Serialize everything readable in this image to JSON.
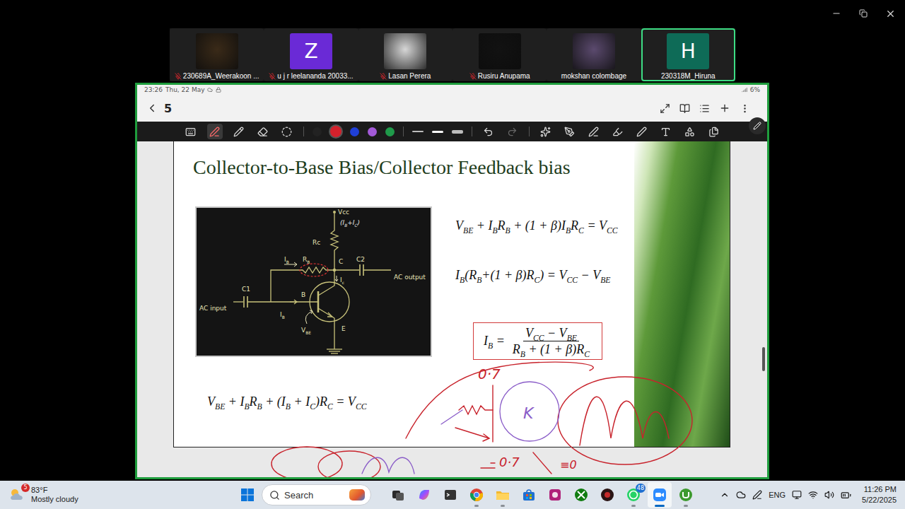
{
  "participants": [
    {
      "name": "230689A_Weerakoon ...",
      "muted": true,
      "kind": "photo",
      "color": "#3a2a18",
      "speaking": false
    },
    {
      "name": "u j r leelananda 20033...",
      "muted": true,
      "kind": "initial",
      "initial": "Z",
      "color": "#6a2ad6",
      "speaking": false
    },
    {
      "name": "Lasan Perera",
      "muted": true,
      "kind": "photo",
      "color": "#d6d6d6",
      "speaking": false
    },
    {
      "name": "Rusiru Anupama",
      "muted": true,
      "kind": "photo",
      "color": "#121212",
      "speaking": false
    },
    {
      "name": "mokshan colombage",
      "muted": false,
      "kind": "photo",
      "color": "#5b4a6e",
      "speaking": false
    },
    {
      "name": "230318M_Hiruna",
      "muted": false,
      "kind": "initial",
      "initial": "H",
      "color": "#0e6b57",
      "speaking": true
    }
  ],
  "tablet": {
    "status": {
      "time": "23:26",
      "date": "Thu, 22 May",
      "battery": "6%"
    },
    "page": "5",
    "tools": [
      {
        "kind": "keyboard",
        "selected": false
      },
      {
        "kind": "pen",
        "selected": true
      },
      {
        "kind": "pencil",
        "selected": false
      },
      {
        "kind": "eraser",
        "selected": false
      },
      {
        "kind": "lasso",
        "selected": false
      }
    ],
    "colors": [
      {
        "color": "#222222",
        "selected": false
      },
      {
        "color": "#d3212c",
        "selected": true
      },
      {
        "color": "#1f3fd6",
        "selected": false
      },
      {
        "color": "#a35ad8",
        "selected": false
      },
      {
        "color": "#1f9a4a",
        "selected": false
      }
    ],
    "widths": [
      {
        "kind": "thin",
        "selected": false
      },
      {
        "kind": "medium",
        "selected": true
      },
      {
        "kind": "thick",
        "selected": false
      }
    ],
    "actions": [
      {
        "kind": "undo",
        "disabled": false
      },
      {
        "kind": "redo",
        "disabled": true
      }
    ],
    "extra_tools": [
      {
        "kind": "magic-pen"
      },
      {
        "kind": "fill-pen"
      },
      {
        "kind": "pen-line"
      },
      {
        "kind": "highlighter"
      },
      {
        "kind": "pen"
      },
      {
        "kind": "text"
      },
      {
        "kind": "shapes"
      },
      {
        "kind": "copy"
      }
    ],
    "scrollbar": {
      "level": 0.66
    }
  },
  "slide": {
    "title": "Collector-to-Base Bias/Collector Feedback bias",
    "circuit": {
      "labels": [
        {
          "parts": [
            [
              "Vcc",
              ""
            ]
          ],
          "kind": "printed"
        },
        {
          "parts": [
            [
              "(I",
              "B"
            ],
            [
              "+I",
              "C"
            ],
            [
              ")",
              ""
            ]
          ],
          "kind": "handwritten"
        },
        {
          "parts": [
            [
              "Rc",
              ""
            ]
          ],
          "kind": "printed"
        },
        {
          "parts": [
            [
              "C",
              ""
            ]
          ],
          "kind": "printed"
        },
        {
          "parts": [
            [
              "C2",
              ""
            ]
          ],
          "kind": "printed"
        },
        {
          "parts": [
            [
              "AC output",
              ""
            ]
          ],
          "kind": "printed"
        },
        {
          "parts": [
            [
              "I",
              "B"
            ]
          ],
          "kind": "printed"
        },
        {
          "parts": [
            [
              "R",
              "B"
            ]
          ],
          "kind": "printed"
        },
        {
          "parts": [
            [
              "I",
              "c"
            ]
          ],
          "kind": "printed"
        },
        {
          "parts": [
            [
              "C1",
              ""
            ]
          ],
          "kind": "printed"
        },
        {
          "parts": [
            [
              "AC input",
              ""
            ]
          ],
          "kind": "printed"
        },
        {
          "parts": [
            [
              "B",
              ""
            ]
          ],
          "kind": "printed"
        },
        {
          "parts": [
            [
              "I",
              "B"
            ]
          ],
          "kind": "printed"
        },
        {
          "parts": [
            [
              "V",
              "BE"
            ]
          ],
          "kind": "printed"
        },
        {
          "parts": [
            [
              "E",
              ""
            ]
          ],
          "kind": "printed"
        }
      ]
    },
    "equations": [
      [
        [
          "V",
          "BE"
        ],
        [
          " + I",
          "B"
        ],
        [
          "R",
          "B"
        ],
        [
          " + (1 + β)I",
          "B"
        ],
        [
          "R",
          "C"
        ],
        [
          " = V",
          "CC"
        ]
      ],
      [
        [
          "I",
          "B"
        ],
        [
          "(R",
          "B"
        ],
        [
          "+(1 + β)R",
          "C"
        ],
        [
          ") = V",
          "CC"
        ],
        [
          " − V",
          "BE"
        ]
      ]
    ],
    "fraction": {
      "lhs": [
        [
          "I",
          "B"
        ],
        [
          " =",
          ""
        ]
      ],
      "numerator": [
        [
          "V",
          "CC"
        ],
        [
          " − V",
          "BE"
        ]
      ],
      "denominator": [
        [
          "R",
          "B"
        ],
        [
          " + (1 + β)R",
          "C"
        ]
      ]
    },
    "bottom_equation": [
      [
        "V",
        "BE"
      ],
      [
        " + I",
        "B"
      ],
      [
        "R",
        "B"
      ],
      [
        " + (I",
        "B"
      ],
      [
        " + I",
        "C"
      ],
      [
        ")R",
        "C"
      ],
      [
        " = V",
        "CC"
      ]
    ]
  },
  "annotations": [
    {
      "text": "0·7",
      "color": "#c8232c"
    },
    {
      "text": "K",
      "color": "#8a5cc8"
    },
    {
      "text": "0·7",
      "color": "#c8232c"
    },
    {
      "text": "≡0",
      "color": "#c8232c"
    }
  ],
  "taskbar": {
    "weather": {
      "temp": "83°F",
      "condition": "Mostly cloudy",
      "badge": "5"
    },
    "search": {
      "placeholder": "Search"
    },
    "apps": [
      {
        "kind": "taskview",
        "running": false,
        "active": false
      },
      {
        "kind": "copilot",
        "running": false,
        "active": false
      },
      {
        "kind": "terminal",
        "running": false,
        "active": false
      },
      {
        "kind": "chrome",
        "running": true,
        "active": false
      },
      {
        "kind": "explorer",
        "running": true,
        "active": false
      },
      {
        "kind": "store",
        "running": false,
        "active": false
      },
      {
        "kind": "pinkapp",
        "running": false,
        "active": false
      },
      {
        "kind": "xbox",
        "running": false,
        "active": false
      },
      {
        "kind": "darkapp",
        "running": false,
        "active": false
      },
      {
        "kind": "whatsapp",
        "running": true,
        "active": false,
        "badge": "48"
      },
      {
        "kind": "zoom",
        "running": true,
        "active": true
      },
      {
        "kind": "utorrent",
        "running": true,
        "active": false
      }
    ],
    "tray": {
      "language": "ENG",
      "time": "11:26 PM",
      "date": "5/22/2025"
    }
  }
}
